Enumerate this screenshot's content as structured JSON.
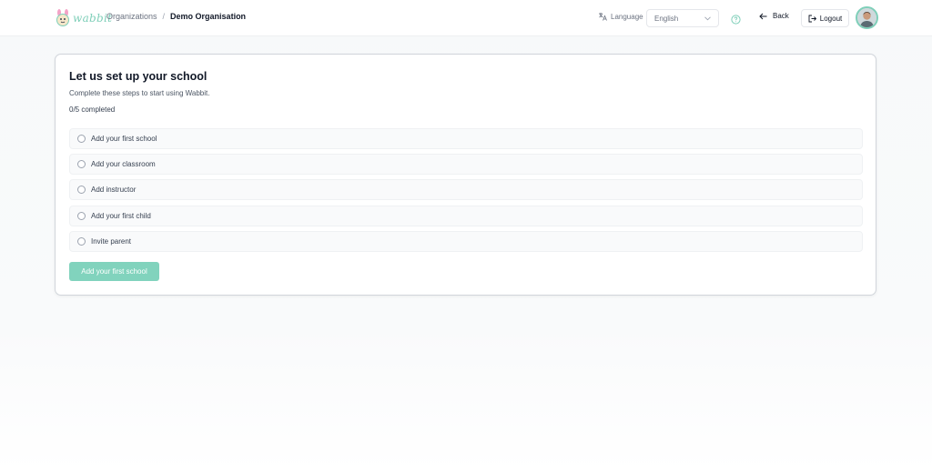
{
  "header": {
    "logo_text": "wabbit",
    "breadcrumb": {
      "parent": "Organizations",
      "separator": "/",
      "current": "Demo Organisation"
    },
    "language_label": "Language",
    "language_select": {
      "selected": "English"
    },
    "back_label": "Back",
    "logout_label": "Logout"
  },
  "setup": {
    "title": "Let us set up your school",
    "subtitle": "Complete these steps to start using Wabbit.",
    "progress": "0/5 completed",
    "steps": [
      {
        "label": "Add your first school",
        "done": false
      },
      {
        "label": "Add your classroom",
        "done": false
      },
      {
        "label": "Add instructor",
        "done": false
      },
      {
        "label": "Add your first child",
        "done": false
      },
      {
        "label": "Invite parent",
        "done": false
      }
    ],
    "cta_label": "Add your first school"
  },
  "colors": {
    "accent": "#7fcfb9",
    "cta_bg": "#81d3bd"
  },
  "icons": {
    "translate": "translate-icon",
    "chevron": "chevron-down-icon",
    "help": "help-icon",
    "back": "arrow-left-icon",
    "logout": "logout-icon"
  }
}
